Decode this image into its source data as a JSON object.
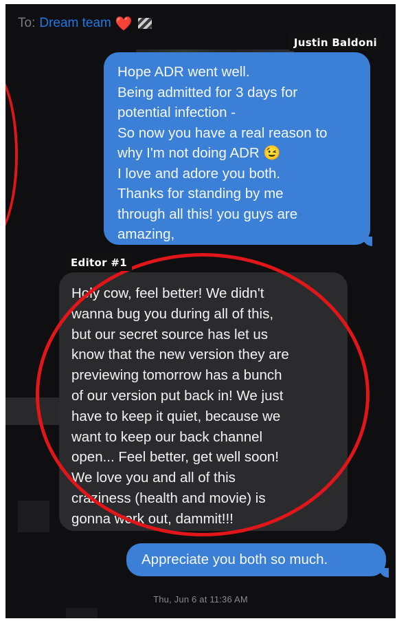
{
  "header": {
    "to_label": "To:",
    "group_name": "Dream team",
    "emoji": "❤️"
  },
  "tags": {
    "sender_out": "Justin Baldoni",
    "sender_in": "Editor #1"
  },
  "messages": [
    {
      "direction": "outgoing",
      "lines": [
        "Hope ADR went well.",
        "Being admitted for 3 days for",
        "potential infection -",
        "So now you have a real reason to",
        "why I'm not doing ADR 😉",
        "I love and adore you both.",
        "Thanks for standing by me",
        "through all this! you guys are",
        "amazing,"
      ]
    },
    {
      "direction": "incoming",
      "lines": [
        "Holy cow, feel better! We didn't",
        "wanna bug you during all of this,",
        "but our secret source has let us",
        "know that the new version they are",
        "previewing tomorrow has a bunch",
        "of our version put back in! We just",
        "have to keep it quiet, because we",
        "want to keep our back channel",
        "open... Feel better, get well soon!",
        "We love you and all of this",
        "craziness (health and movie) is",
        "gonna work out, dammit!!!"
      ]
    },
    {
      "direction": "outgoing",
      "text": "Appreciate you both so much."
    }
  ],
  "timestamp": "Thu, Jun 6 at 11:36 AM",
  "colors": {
    "outgoing_bubble": "#3b7fd6",
    "incoming_bubble": "#2b2b2e",
    "annotation_circle": "#e0161b",
    "group_name": "#1e78e6"
  }
}
